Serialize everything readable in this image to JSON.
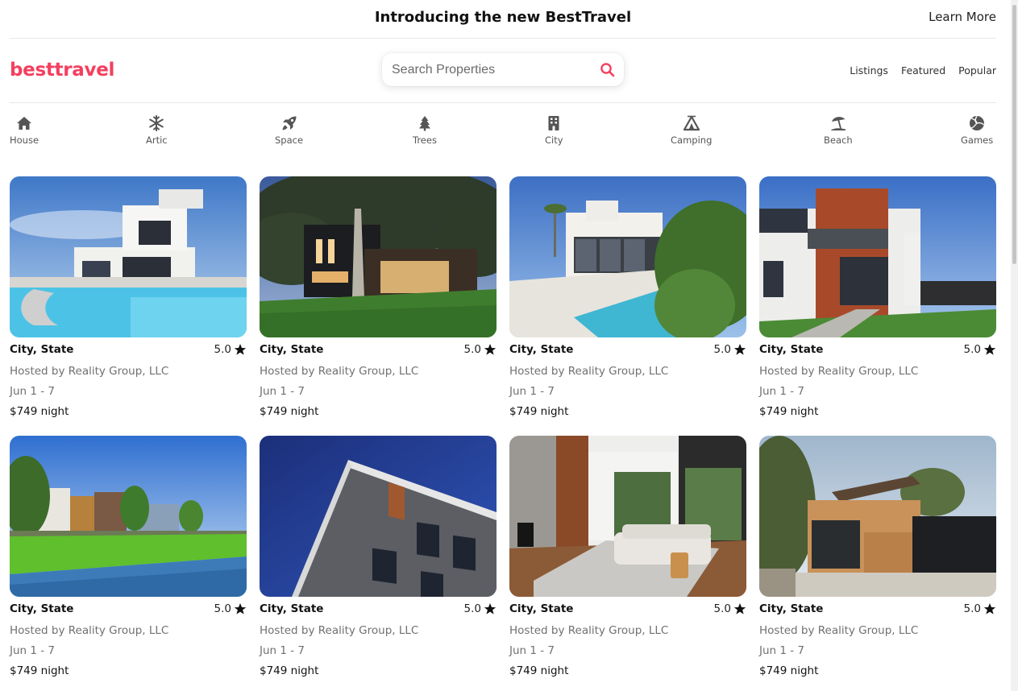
{
  "announcement": {
    "title": "Introducing the new BestTravel",
    "link": "Learn More"
  },
  "header": {
    "logo": "besttravel",
    "search_placeholder": "Search Properties",
    "nav": [
      "Listings",
      "Featured",
      "Popular"
    ]
  },
  "categories": [
    {
      "label": "House",
      "icon": "house-icon"
    },
    {
      "label": "Artic",
      "icon": "snowflake-icon"
    },
    {
      "label": "Space",
      "icon": "rocket-icon"
    },
    {
      "label": "Trees",
      "icon": "tree-icon"
    },
    {
      "label": "City",
      "icon": "building-icon"
    },
    {
      "label": "Camping",
      "icon": "tent-icon"
    },
    {
      "label": "Beach",
      "icon": "umbrella-beach-icon"
    },
    {
      "label": "Games",
      "icon": "volleyball-icon"
    }
  ],
  "colors": {
    "brand": "#f43f5e",
    "icon": "#555555",
    "muted_text": "#707070"
  },
  "listings": [
    {
      "location": "City, State",
      "rating": "5.0",
      "host": "Hosted by Reality Group, LLC",
      "dates": "Jun 1 - 7",
      "price": "$749 night",
      "photo": "white villa with pool"
    },
    {
      "location": "City, State",
      "rating": "5.0",
      "host": "Hosted by Reality Group, LLC",
      "dates": "Jun 1 - 7",
      "price": "$749 night",
      "photo": "modern house under tree at dusk"
    },
    {
      "location": "City, State",
      "rating": "5.0",
      "host": "Hosted by Reality Group, LLC",
      "dates": "Jun 1 - 7",
      "price": "$749 night",
      "photo": "white house with pool and plants"
    },
    {
      "location": "City, State",
      "rating": "5.0",
      "host": "Hosted by Reality Group, LLC",
      "dates": "Jun 1 - 7",
      "price": "$749 night",
      "photo": "modern house with wood facade"
    },
    {
      "location": "City, State",
      "rating": "5.0",
      "host": "Hosted by Reality Group, LLC",
      "dates": "Jun 1 - 7",
      "price": "$749 night",
      "photo": "townhouses by canal"
    },
    {
      "location": "City, State",
      "rating": "5.0",
      "host": "Hosted by Reality Group, LLC",
      "dates": "Jun 1 - 7",
      "price": "$749 night",
      "photo": "brick building against blue sky"
    },
    {
      "location": "City, State",
      "rating": "5.0",
      "host": "Hosted by Reality Group, LLC",
      "dates": "Jun 1 - 7",
      "price": "$749 night",
      "photo": "living room interior"
    },
    {
      "location": "City, State",
      "rating": "5.0",
      "host": "Hosted by Reality Group, LLC",
      "dates": "Jun 1 - 7",
      "price": "$749 night",
      "photo": "wooden house with black fence"
    }
  ]
}
